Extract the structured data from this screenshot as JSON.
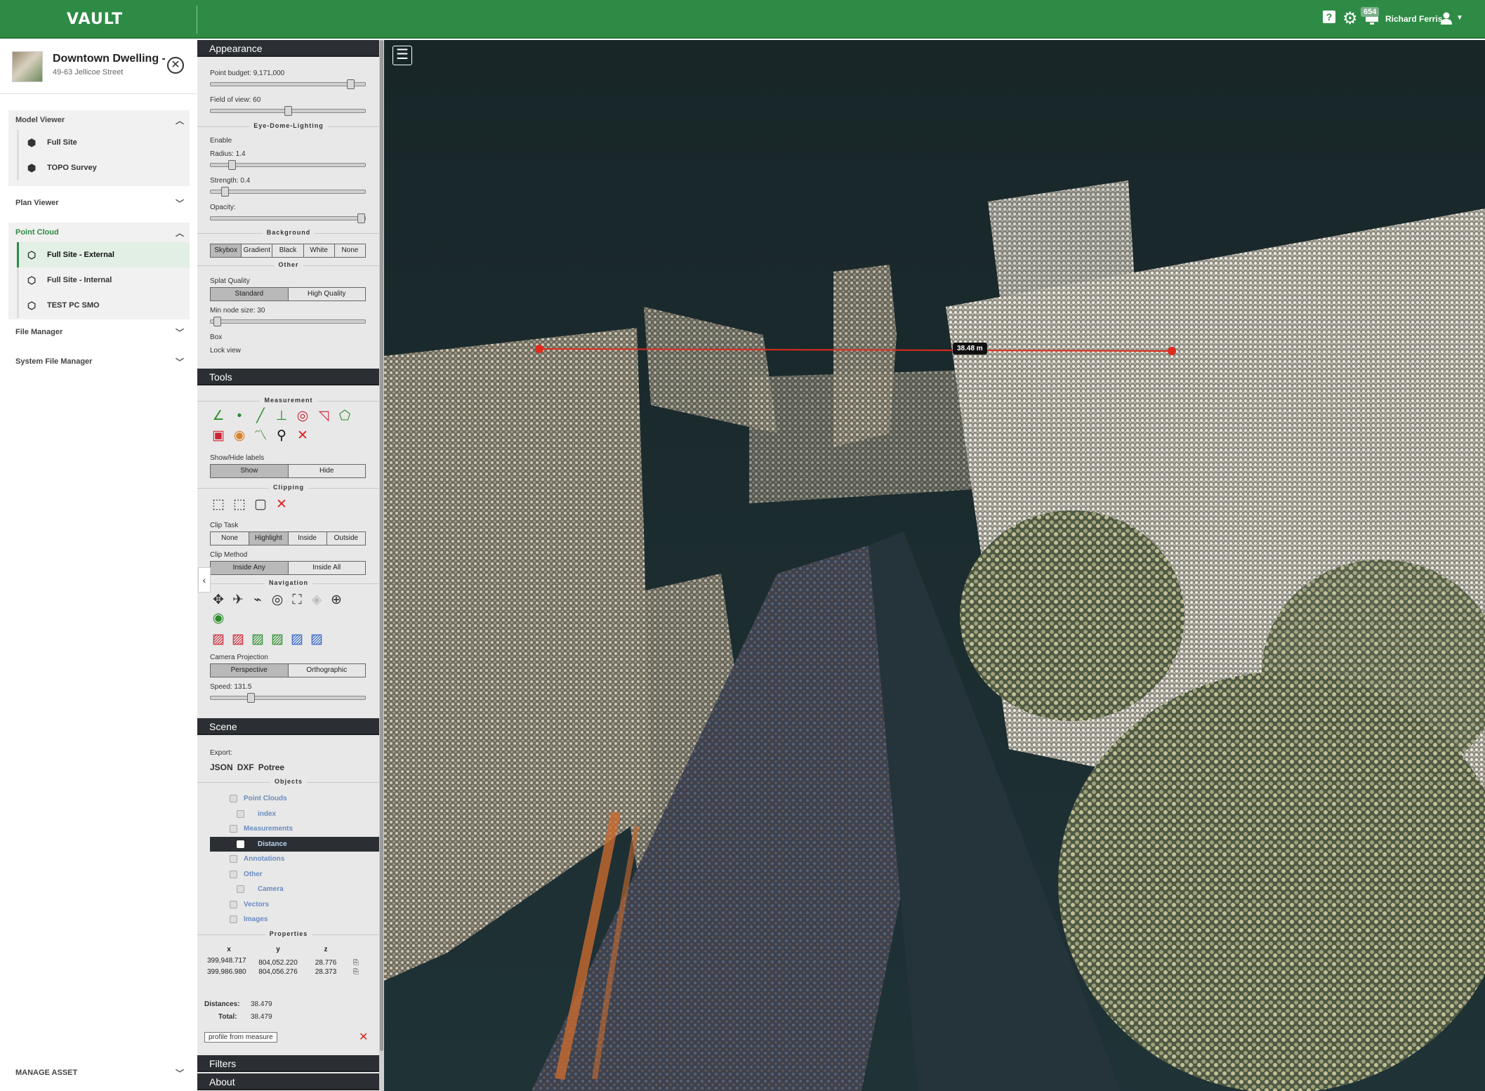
{
  "topbar": {
    "logo": "VAULT",
    "help_icon": "help-icon",
    "settings_icon": "gear-icon",
    "notifications_count": "654",
    "user_name": "Richard Ferris",
    "colors": {
      "brand": "#2e8b45"
    }
  },
  "asset": {
    "title": "Downtown Dwelling - (",
    "address": "49-63 Jellicoe Street"
  },
  "nav": {
    "model_viewer": {
      "label": "Model Viewer",
      "items": [
        "Full Site",
        "TOPO Survey"
      ]
    },
    "plan_viewer": {
      "label": "Plan Viewer"
    },
    "point_cloud": {
      "label": "Point Cloud",
      "items": [
        "Full Site - External",
        "Full Site - Internal",
        "TEST PC SMO"
      ],
      "active": "Full Site - External"
    },
    "file_manager": {
      "label": "File Manager"
    },
    "system_file_manager": {
      "label": "System File Manager"
    },
    "manage_asset": {
      "label": "MANAGE ASSET"
    }
  },
  "appearance": {
    "title": "Appearance",
    "point_budget": "Point budget: 9,171,000",
    "point_budget_level": 0.93,
    "fov": "Field of view: 60",
    "fov_level": 0.5,
    "edl_title": "Eye-Dome-Lighting",
    "enable": "Enable",
    "radius": "Radius: 1.4",
    "radius_level": 0.12,
    "strength": "Strength: 0.4",
    "strength_level": 0.07,
    "opacity": "Opacity:",
    "opacity_level": 1.0,
    "background_title": "Background",
    "background_options": [
      "Skybox",
      "Gradient",
      "Black",
      "White",
      "None"
    ],
    "other_title": "Other",
    "splat_quality": "Splat Quality",
    "splat_options": [
      "Standard",
      "High Quality"
    ],
    "min_node_size": "Min node size: 30",
    "min_node_level": 0.02,
    "box": "Box",
    "lock_view": "Lock view"
  },
  "tools": {
    "title": "Tools",
    "measurement_title": "Measurement",
    "show_hide_labels": "Show/Hide labels",
    "labels_options": [
      "Show",
      "Hide"
    ],
    "clipping_title": "Clipping",
    "clip_task": "Clip Task",
    "clip_task_options": [
      "None",
      "Highlight",
      "Inside",
      "Outside"
    ],
    "clip_method": "Clip Method",
    "clip_method_options": [
      "Inside Any",
      "Inside All"
    ],
    "navigation_title": "Navigation",
    "camera_projection": "Camera Projection",
    "projection_options": [
      "Perspective",
      "Orthographic"
    ],
    "speed": "Speed: 131.5",
    "speed_level": 0.25
  },
  "scene": {
    "title": "Scene",
    "export": "Export:",
    "export_formats": [
      "JSON",
      "DXF",
      "Potree"
    ],
    "objects_title": "Objects",
    "tree": [
      {
        "label": "Point Clouds",
        "level": 0
      },
      {
        "label": "index",
        "level": 1
      },
      {
        "label": "Measurements",
        "level": 0
      },
      {
        "label": "Distance",
        "level": 1
      },
      {
        "label": "Annotations",
        "level": 0
      },
      {
        "label": "Other",
        "level": 0
      },
      {
        "label": "Camera",
        "level": 1
      },
      {
        "label": "Vectors",
        "level": 0
      },
      {
        "label": "Images",
        "level": 0
      }
    ],
    "properties_title": "Properties",
    "prop_headers": [
      "x",
      "y",
      "z"
    ],
    "prop_rows": [
      [
        "399,948.717",
        "804,052.220",
        "28.776"
      ],
      [
        "399,986.980",
        "804,056.276",
        "28.373"
      ]
    ],
    "distances_label": "Distances:",
    "distances_value": "38.479",
    "total_label": "Total:",
    "total_value": "38.479",
    "profile_button": "profile from measure"
  },
  "filters": {
    "title": "Filters"
  },
  "about": {
    "title": "About"
  },
  "viewer": {
    "distance_label": "38.48 m",
    "menu_icon": "menu-icon",
    "collapse_icon": "chevron-left-icon"
  }
}
